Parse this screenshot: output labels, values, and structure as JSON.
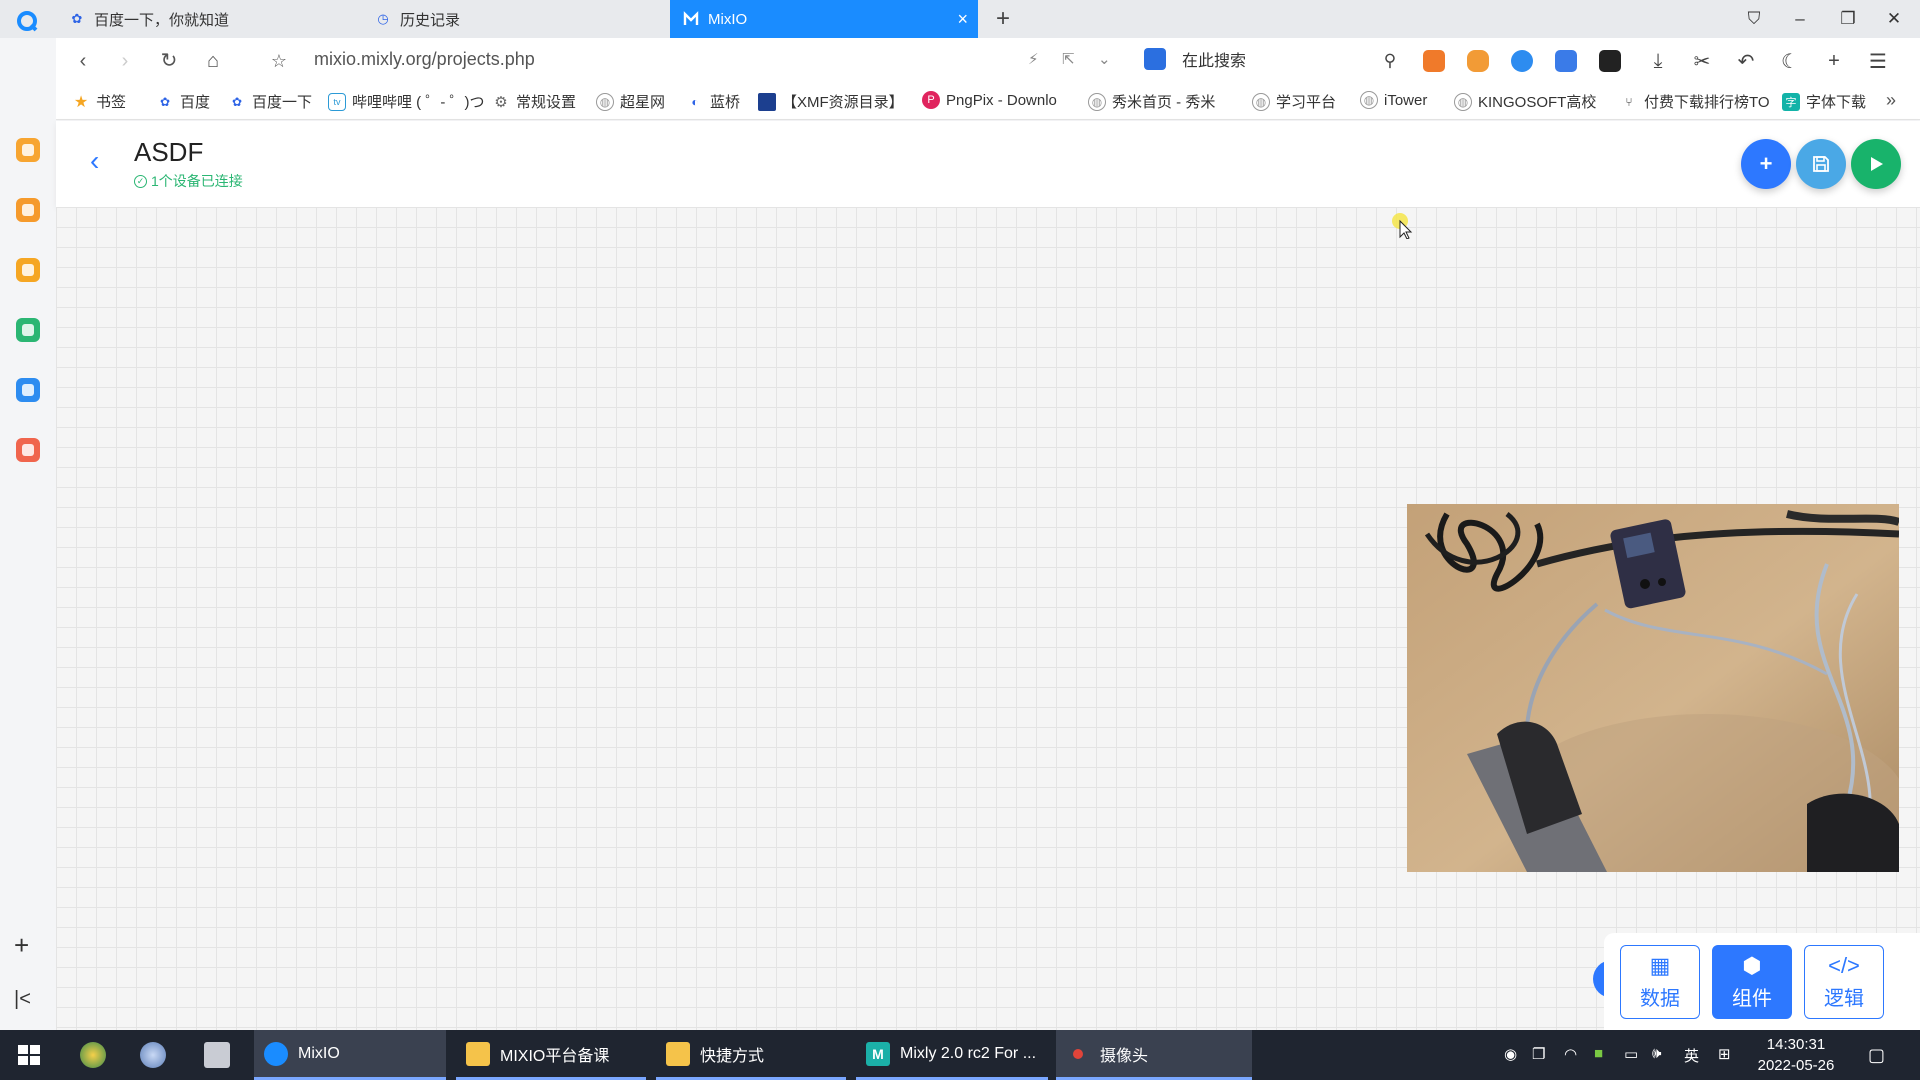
{
  "browser": {
    "tabs": [
      {
        "label": "百度一下，你就知道",
        "icon": "baidu-icon"
      },
      {
        "label": "历史记录",
        "icon": "history-icon"
      },
      {
        "label": "MixIO",
        "icon": "mixio-icon",
        "active": true
      }
    ],
    "url": "mixio.mixly.org/projects.php",
    "search_placeholder": "在此搜索",
    "bookmarks": [
      {
        "label": "书签",
        "icon": "star-icon"
      },
      {
        "label": "百度",
        "icon": "baidu-icon"
      },
      {
        "label": "百度一下",
        "icon": "baidu-icon"
      },
      {
        "label": "哔哩哔哩 ( ゜- ゜)つ",
        "icon": "bilibili-icon"
      },
      {
        "label": "常规设置",
        "icon": "gear-icon"
      },
      {
        "label": "超星网",
        "icon": "globe-icon"
      },
      {
        "label": "蓝桥",
        "icon": "lanqiao-icon"
      },
      {
        "label": "【XMF资源目录】",
        "icon": "xmf-icon"
      },
      {
        "label": "PngPix - Downlo",
        "icon": "pngpix-icon"
      },
      {
        "label": "秀米首页 - 秀米",
        "icon": "globe-icon"
      },
      {
        "label": "学习平台",
        "icon": "globe-icon"
      },
      {
        "label": "iTower",
        "icon": "globe-icon"
      },
      {
        "label": "KINGOSOFT高校",
        "icon": "globe-icon"
      },
      {
        "label": "付费下载排行榜TO",
        "icon": "share-icon"
      },
      {
        "label": "字体下载",
        "icon": "font-icon"
      }
    ]
  },
  "page": {
    "title": "ASDF",
    "status": "1个设备已连接",
    "panel_tabs": [
      {
        "label": "数据",
        "icon": "table-icon"
      },
      {
        "label": "组件",
        "icon": "cube-icon",
        "active": true
      },
      {
        "label": "逻辑",
        "icon": "code-icon"
      }
    ]
  },
  "taskbar": {
    "apps": [
      {
        "label": "MixIO",
        "state": "active"
      },
      {
        "label": "MIXIO平台备课",
        "state": "running"
      },
      {
        "label": "快捷方式",
        "state": "running"
      },
      {
        "label": "Mixly 2.0 rc2 For ...",
        "state": "running"
      },
      {
        "label": "摄像头",
        "state": "active"
      }
    ],
    "ime": "英",
    "time": "14:30:31",
    "date": "2022-05-26"
  },
  "colors": {
    "accent": "#2d78ff",
    "active_tab": "#1a8cff",
    "status_green": "#2bb673",
    "save_button": "#4aa8e6",
    "run_button": "#18b36b"
  }
}
